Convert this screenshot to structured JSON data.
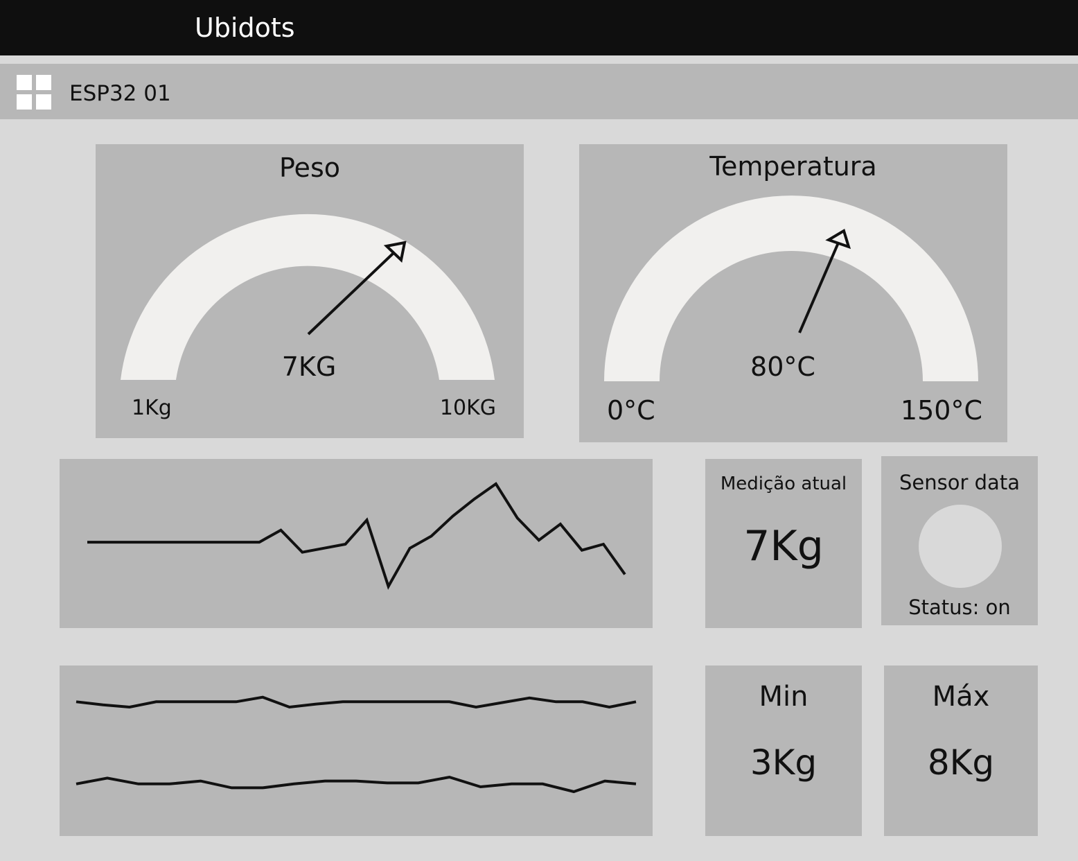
{
  "app": {
    "title": "Ubidots"
  },
  "device": {
    "name": "ESP32 01",
    "menu_icon": "grid-icon"
  },
  "gauges": {
    "weight": {
      "title": "Peso",
      "value_label": "7KG",
      "min_label": "1Kg",
      "max_label": "10KG",
      "value": 7,
      "min": 1,
      "max": 10
    },
    "temperature": {
      "title": "Temperatura",
      "value_label": "80°C",
      "min_label": "0°C",
      "max_label": "150°C",
      "value": 80,
      "min": 0,
      "max": 150
    }
  },
  "cards": {
    "current": {
      "title": "Medição atual",
      "value": "7Kg"
    },
    "sensor": {
      "title": "Sensor data",
      "status": "Status: on"
    },
    "min": {
      "title": "Min",
      "value": "3Kg"
    },
    "max": {
      "title": "Máx",
      "value": "8Kg"
    }
  },
  "colors": {
    "topbar": "#0f0f0f",
    "panel": "#b7b7b7",
    "background": "#d9d9d9",
    "gauge_arc": "#f1f0ee",
    "line": "#111111"
  },
  "chart_data": [
    {
      "type": "line",
      "series": [
        {
          "values": [
            62,
            62,
            62,
            62,
            62,
            62,
            62,
            62,
            62,
            74,
            52,
            56,
            60,
            84,
            18,
            56,
            68,
            88,
            105,
            120,
            86,
            64,
            80,
            54,
            60,
            30
          ]
        }
      ]
    },
    {
      "type": "line",
      "series": [
        {
          "values": [
            72,
            68,
            65,
            72,
            72,
            72,
            72,
            78,
            65,
            69,
            72,
            72,
            72,
            72,
            72,
            65,
            71,
            77,
            72,
            72,
            65,
            72
          ]
        },
        {
          "values": [
            38,
            44,
            38,
            38,
            41,
            34,
            34,
            38,
            41,
            41,
            39,
            39,
            45,
            35,
            38,
            38,
            30,
            41,
            38
          ]
        }
      ]
    }
  ]
}
